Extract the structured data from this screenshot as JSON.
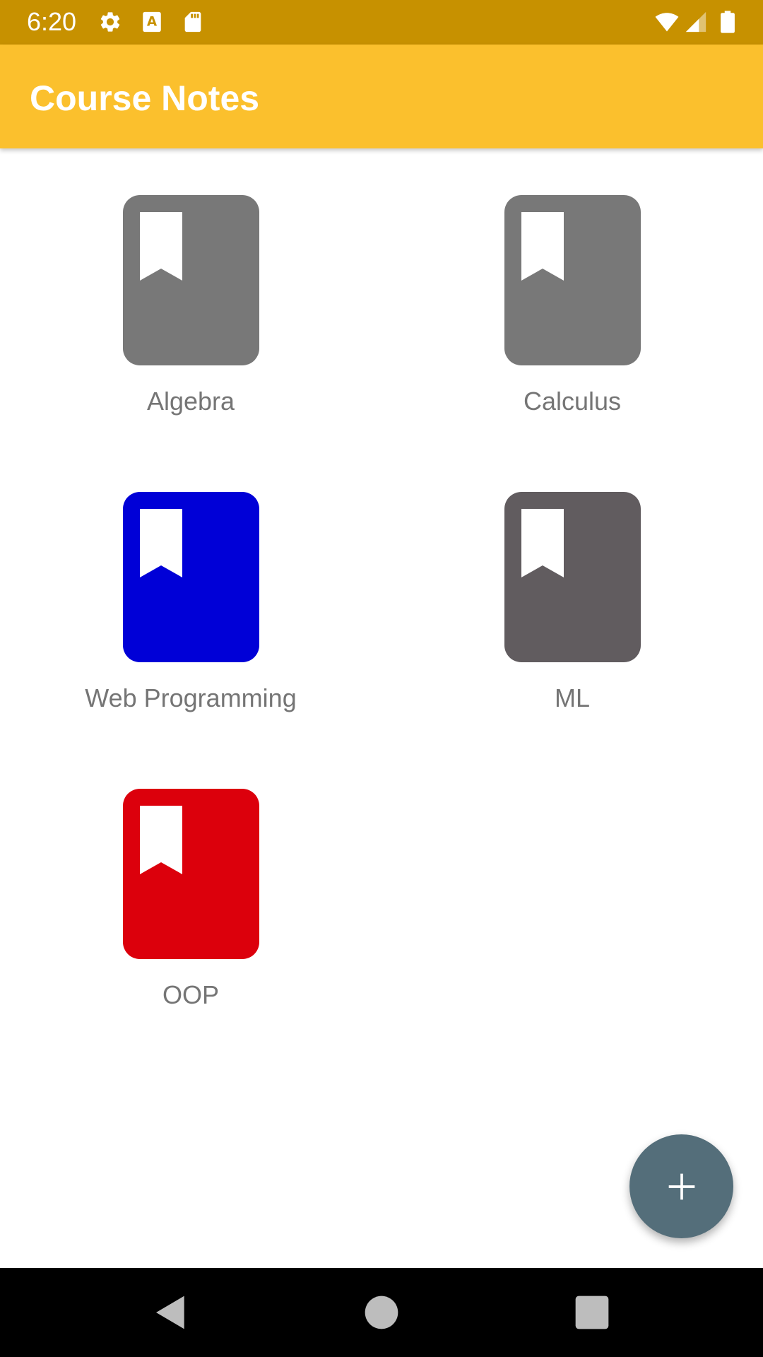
{
  "status_bar": {
    "time": "6:20",
    "icons": [
      "gear-icon",
      "font-a-icon",
      "sd-card-icon",
      "wifi-icon",
      "signal-icon",
      "battery-icon"
    ]
  },
  "app_bar": {
    "title": "Course Notes"
  },
  "courses": [
    {
      "name": "Algebra",
      "color": "#787878"
    },
    {
      "name": "Calculus",
      "color": "#787878"
    },
    {
      "name": "Web Programming",
      "color": "#0000d7"
    },
    {
      "name": "ML",
      "color": "#615c5f"
    },
    {
      "name": "OOP",
      "color": "#dc000c"
    }
  ],
  "fab": {
    "icon": "plus-icon",
    "color": "#546e7a"
  },
  "nav_bar": {
    "buttons": [
      "back-icon",
      "home-icon",
      "recents-icon"
    ]
  }
}
